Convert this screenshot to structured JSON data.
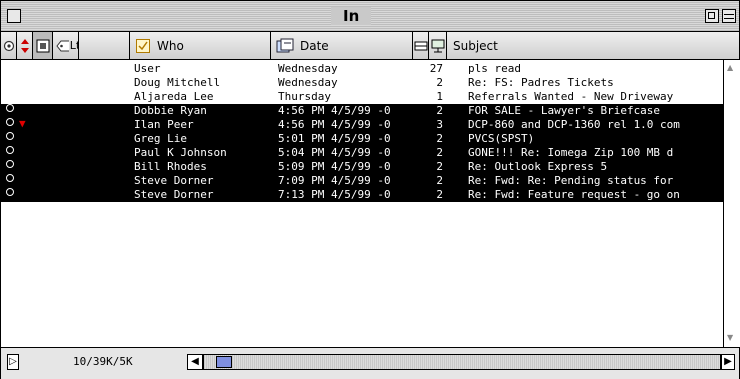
{
  "window": {
    "title": "In"
  },
  "columns": {
    "who": "Who",
    "date": "Date",
    "subject": "Subject",
    "label_partial": "Lt"
  },
  "messages": [
    {
      "from": "User",
      "date": "Wednesday",
      "size": "27",
      "subject": "pls read",
      "selected": false,
      "status": "",
      "priority": ""
    },
    {
      "from": "Doug Mitchell",
      "date": "Wednesday",
      "size": "2",
      "subject": "Re: FS: Padres Tickets",
      "selected": false,
      "status": "",
      "priority": ""
    },
    {
      "from": "Aljareda Lee",
      "date": "Thursday",
      "size": "1",
      "subject": "Referrals Wanted - New Driveway",
      "selected": false,
      "status": "",
      "priority": ""
    },
    {
      "from": "Dobbie Ryan",
      "date": "4:56 PM 4/5/99 -0",
      "size": "2",
      "subject": "FOR SALE - Lawyer's Briefcase",
      "selected": true,
      "status": "read-dot",
      "priority": ""
    },
    {
      "from": "Ilan Peer",
      "date": "4:56 PM 4/5/99 -0",
      "size": "3",
      "subject": "DCP-860 and DCP-1360 rel 1.0 com",
      "selected": true,
      "status": "read-dot",
      "priority": "high"
    },
    {
      "from": "Greg Lie",
      "date": "5:01 PM 4/5/99 -0",
      "size": "2",
      "subject": "PVCS(SPST)",
      "selected": true,
      "status": "read-dot",
      "priority": ""
    },
    {
      "from": "Paul K Johnson",
      "date": "5:04 PM 4/5/99 -0",
      "size": "2",
      "subject": "GONE!!! Re: Iomega Zip 100 MB d",
      "selected": true,
      "status": "read-dot",
      "priority": ""
    },
    {
      "from": "Bill Rhodes",
      "date": "5:09 PM 4/5/99 -0",
      "size": "2",
      "subject": "Re: Outlook Express 5",
      "selected": true,
      "status": "read-dot",
      "priority": ""
    },
    {
      "from": "Steve Dorner",
      "date": "7:09 PM 4/5/99 -0",
      "size": "2",
      "subject": "Re: Fwd: Re: Pending status for",
      "selected": true,
      "status": "read-dot",
      "priority": ""
    },
    {
      "from": "Steve Dorner",
      "date": "7:13 PM 4/5/99 -0",
      "size": "2",
      "subject": "Re: Fwd: Feature request - go on",
      "selected": true,
      "status": "read-dot",
      "priority": ""
    }
  ],
  "status_bar": {
    "mailbox_info": "10/39K/5K"
  },
  "icons": {
    "close_box": "close-box-icon",
    "zoom_box": "zoom-box-icon",
    "collapse_box": "collapse-box-icon",
    "status_column": "status-column-icon",
    "priority_column": "priority-column-icon",
    "attachment_column": "attachment-column-icon",
    "label_column": "label-column-icon",
    "who_column": "who-column-icon",
    "date_column": "date-column-icon",
    "size_column": "size-column-icon",
    "server_column": "server-column-icon"
  },
  "colors": {
    "selection_bg": "#000000",
    "selection_text": "#ffffff",
    "priority_mark": "#e00000",
    "scroll_thumb": "#7f8fe0"
  }
}
